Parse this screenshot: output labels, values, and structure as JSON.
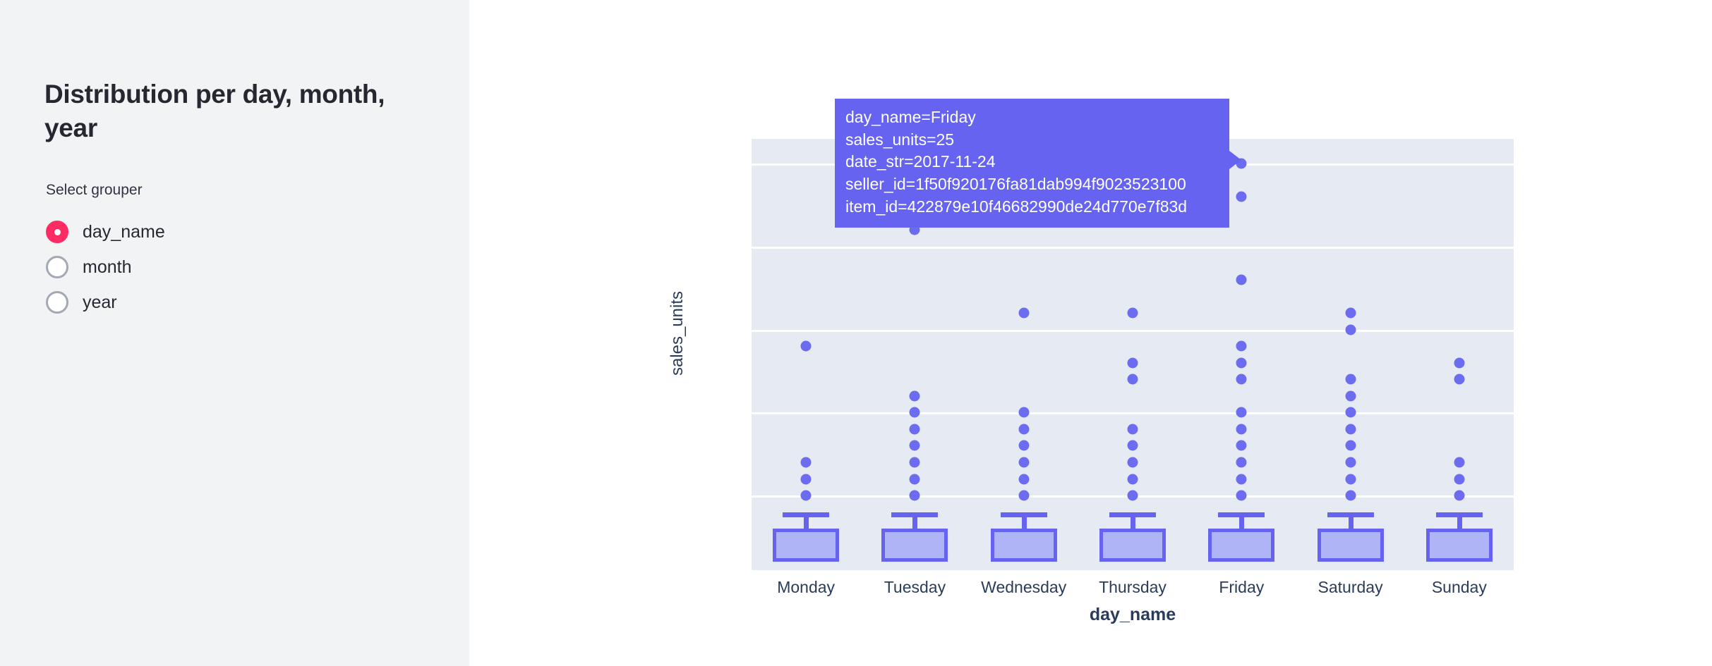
{
  "sidebar": {
    "title": "Distribution per day, month, year",
    "grouper_label": "Select grouper",
    "radio_options": [
      {
        "label": "day_name",
        "selected": true
      },
      {
        "label": "month",
        "selected": false
      },
      {
        "label": "year",
        "selected": false
      }
    ],
    "background_color": "#f2f3f5",
    "accent_color": "#ff2b63"
  },
  "tooltip": {
    "lines": [
      "day_name=Friday",
      "sales_units=25",
      "date_str=2017-11-24",
      "seller_id=1f50f920176fa81dab994f9023523100",
      "item_id=422879e10f46682990de24d770e7f83d"
    ],
    "background_color": "#6563f0",
    "text_color": "#ffffff"
  },
  "chart_data": {
    "type": "box",
    "title": "",
    "xlabel": "day_name",
    "ylabel": "sales_units",
    "categories": [
      "Monday",
      "Tuesday",
      "Wednesday",
      "Thursday",
      "Friday",
      "Saturday",
      "Sunday"
    ],
    "yticks": [
      5,
      10,
      15,
      20,
      25
    ],
    "ylim": [
      0.5,
      26.5
    ],
    "grid": true,
    "legend": "none",
    "plot_bgcolor": "#e5eaf3",
    "marker_color": "#6c6cf0",
    "box_fill_color": "#aeb4f5",
    "box_line_color": "#6563f0",
    "points": [
      {
        "category": "Monday",
        "values": [
          14,
          7,
          6,
          5
        ]
      },
      {
        "category": "Tuesday",
        "values": [
          21,
          11,
          10,
          9,
          8,
          7,
          6,
          5
        ]
      },
      {
        "category": "Wednesday",
        "values": [
          16,
          10,
          9,
          8,
          7,
          6,
          5
        ]
      },
      {
        "category": "Thursday",
        "values": [
          16,
          13,
          12,
          9,
          8,
          7,
          6,
          5
        ]
      },
      {
        "category": "Friday",
        "values": [
          25,
          23,
          18,
          14,
          13,
          12,
          10,
          9,
          8,
          7,
          6,
          5
        ]
      },
      {
        "category": "Saturday",
        "values": [
          16,
          15,
          12,
          11,
          10,
          9,
          8,
          7,
          6,
          5
        ]
      },
      {
        "category": "Sunday",
        "values": [
          13,
          12,
          7,
          6,
          5
        ]
      }
    ],
    "boxes": [
      {
        "category": "Monday",
        "q1": 1,
        "median": 2,
        "q3": 3,
        "upper_whisker": 4
      },
      {
        "category": "Tuesday",
        "q1": 1,
        "median": 2,
        "q3": 3,
        "upper_whisker": 4
      },
      {
        "category": "Wednesday",
        "q1": 1,
        "median": 2,
        "q3": 3,
        "upper_whisker": 4
      },
      {
        "category": "Thursday",
        "q1": 1,
        "median": 2,
        "q3": 3,
        "upper_whisker": 4
      },
      {
        "category": "Friday",
        "q1": 1,
        "median": 2,
        "q3": 3,
        "upper_whisker": 4
      },
      {
        "category": "Saturday",
        "q1": 1,
        "median": 2,
        "q3": 3,
        "upper_whisker": 4
      },
      {
        "category": "Sunday",
        "q1": 1,
        "median": 2,
        "q3": 3,
        "upper_whisker": 4
      }
    ]
  }
}
